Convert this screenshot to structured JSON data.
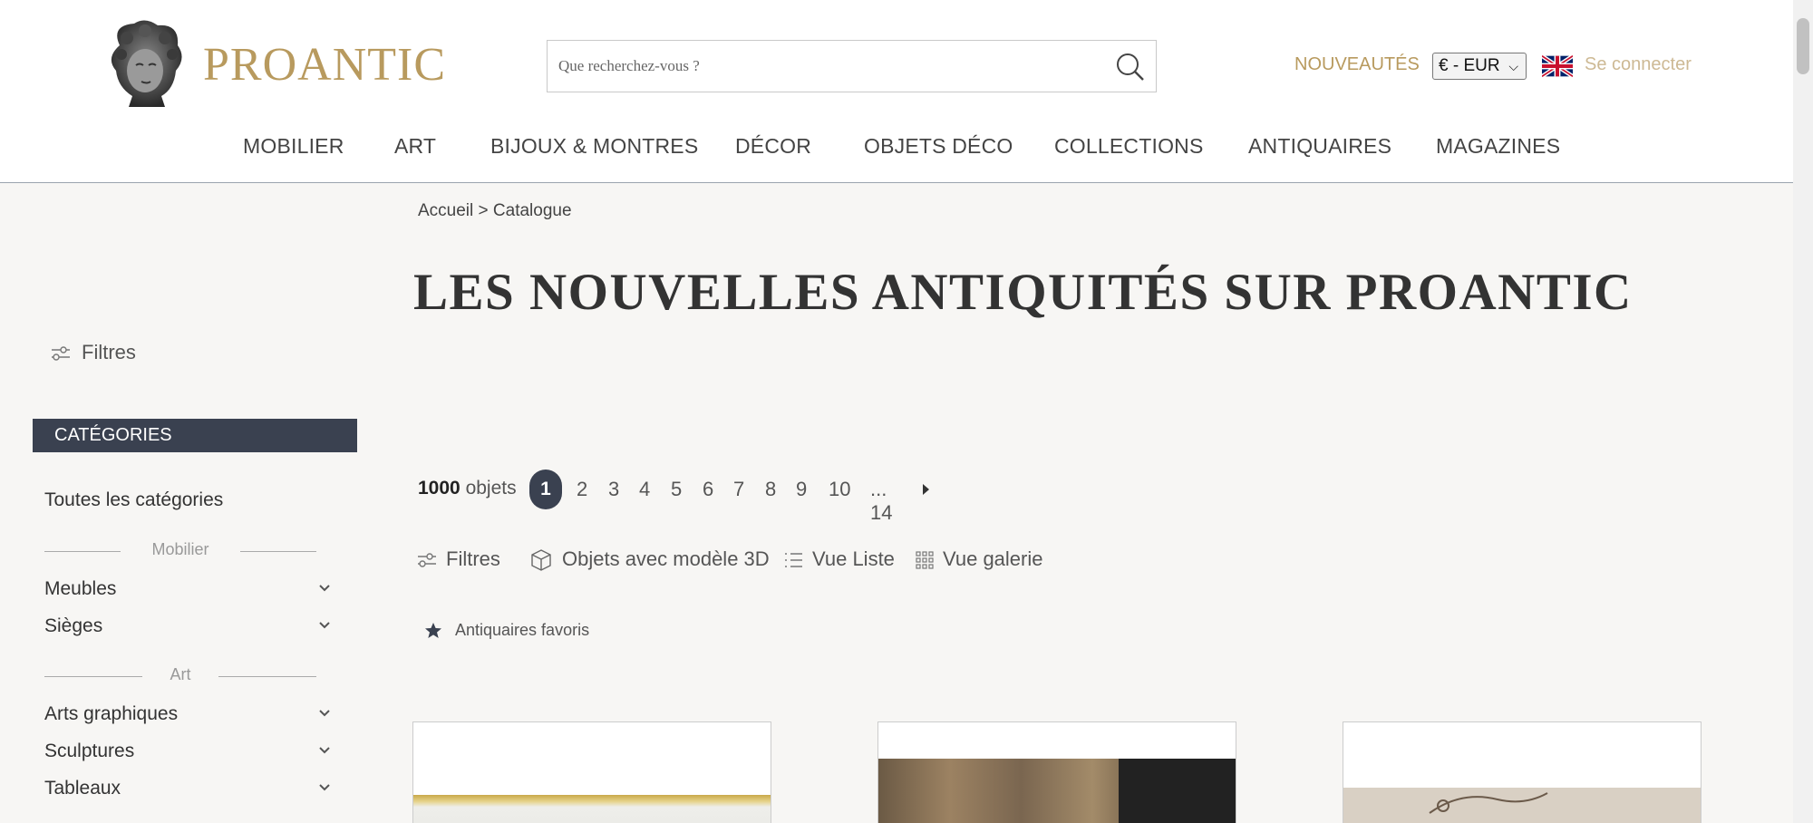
{
  "header": {
    "logo_text": "PROANTIC",
    "search_placeholder": "Que recherchez-vous ?",
    "nouveautes": "NOUVEAUTÉS",
    "currency": "€ - EUR",
    "login": "Se connecter",
    "brand_color": "#b89a5e"
  },
  "nav": [
    "MOBILIER",
    "ART",
    "BIJOUX & MONTRES",
    "DÉCOR",
    "OBJETS DÉCO",
    "COLLECTIONS",
    "ANTIQUAIRES",
    "MAGAZINES"
  ],
  "breadcrumb": {
    "home": "Accueil",
    "sep": ">",
    "current": "Catalogue"
  },
  "title": "LES NOUVELLES ANTIQUITÉS SUR PROANTIC",
  "sidebar": {
    "filters": "Filtres",
    "categories_header": "CATÉGORIES",
    "all_categories": "Toutes les catégories",
    "groups": [
      {
        "label": "Mobilier",
        "items": [
          "Meubles",
          "Sièges"
        ]
      },
      {
        "label": "Art",
        "items": [
          "Arts graphiques",
          "Sculptures",
          "Tableaux"
        ]
      }
    ]
  },
  "results": {
    "count": "1000",
    "count_label": "objets",
    "pages": [
      "1",
      "2",
      "3",
      "4",
      "5",
      "6",
      "7",
      "8",
      "9",
      "10",
      "... 14"
    ],
    "current_page": "1"
  },
  "toolbar": {
    "filters": "Filtres",
    "objects_3d": "Objets avec modèle 3D",
    "list_view": "Vue Liste",
    "gallery_view": "Vue galerie",
    "favorite_dealers": "Antiquaires favoris"
  },
  "colors": {
    "dark": "#3a4150",
    "accent": "#b89a5e"
  }
}
